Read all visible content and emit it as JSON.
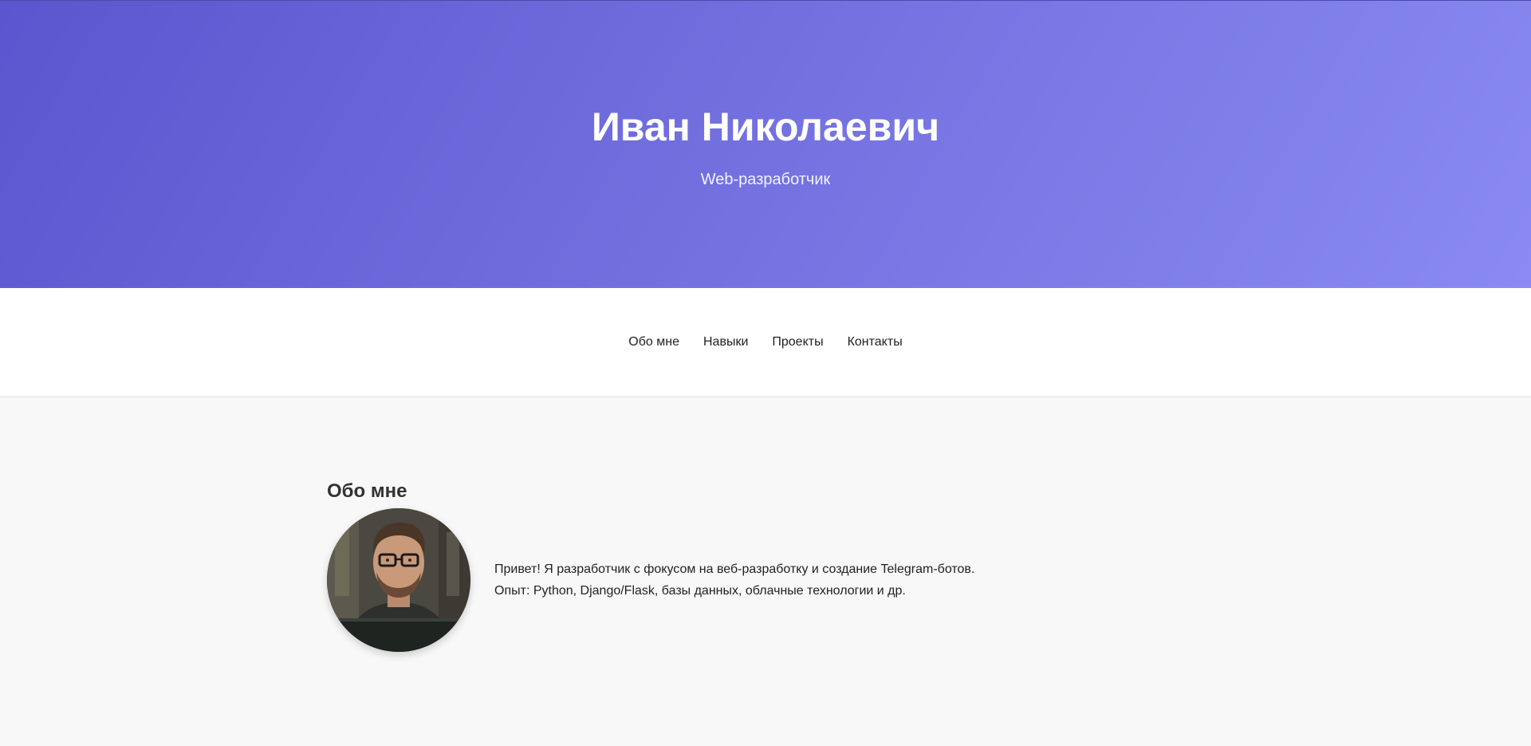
{
  "hero": {
    "name": "Иван Николаевич",
    "subtitle": "Web-разработчик"
  },
  "nav": {
    "items": [
      {
        "label": "Обо мне"
      },
      {
        "label": "Навыки"
      },
      {
        "label": "Проекты"
      },
      {
        "label": "Контакты"
      }
    ]
  },
  "about": {
    "title": "Обо мне",
    "line1": "Привет! Я разработчик с фокусом на веб-разработку и создание Telegram-ботов.",
    "line2": "Опыт: Python, Django/Flask, базы данных, облачные технологии и др."
  },
  "colors": {
    "hero_start": "#5a56cf",
    "hero_end": "#8a8af2"
  }
}
